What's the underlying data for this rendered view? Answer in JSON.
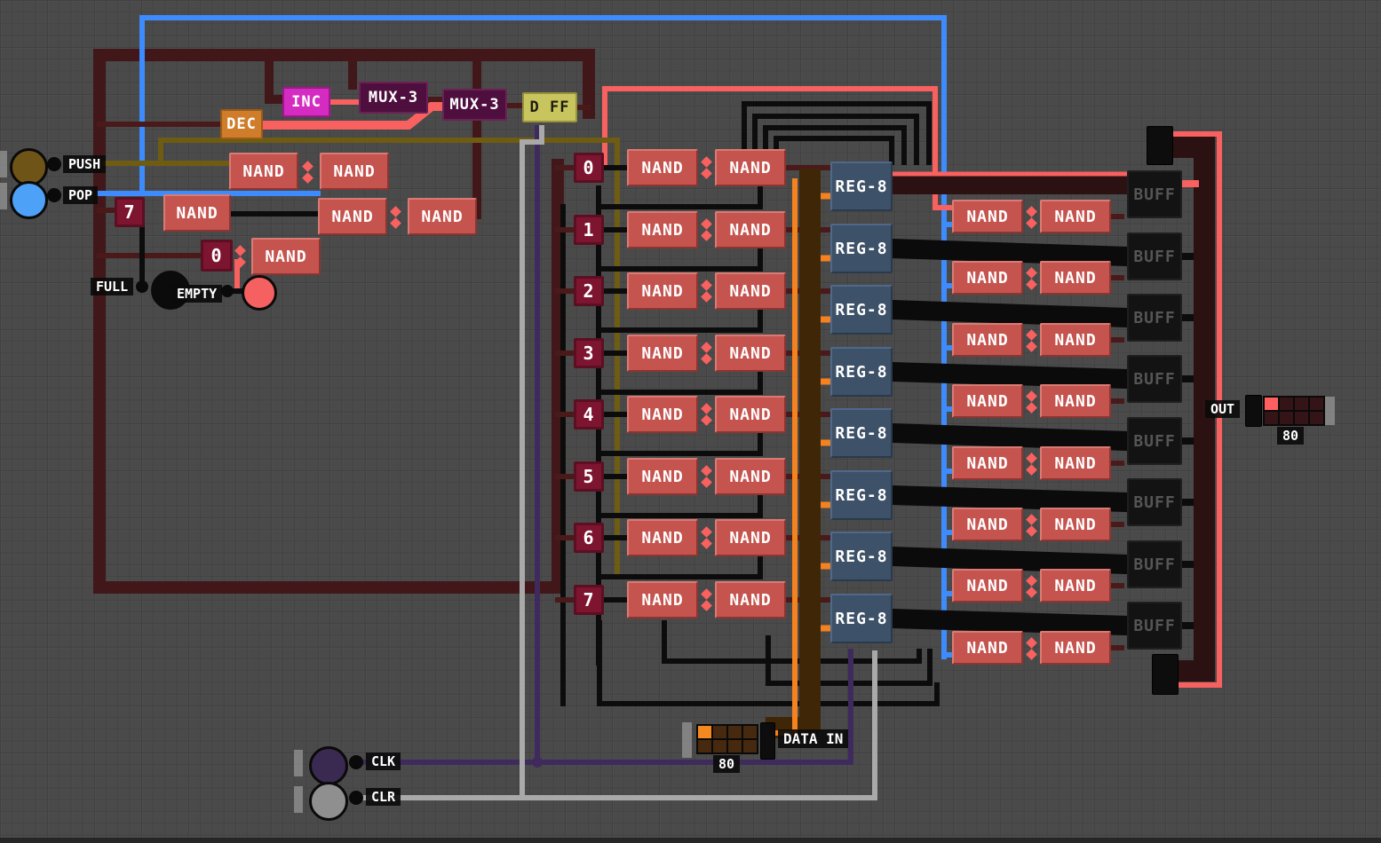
{
  "palette": {
    "wire_blue": "#3d8bfd",
    "wire_on_red": "#f8615f",
    "wire_dark_red": "#4a1a1a",
    "bus_maroon": "#421719",
    "bus_out_dark": "#2c1113",
    "wire_black": "#0c0c0c",
    "wire_olive": "#6e5c12",
    "wire_orange": "#f5821e",
    "bus_brown": "#3f2607",
    "wire_purple": "#3f2a5e",
    "wire_gray": "#a9a9a9",
    "nand_red": "#c5544f",
    "reg_blue": "#3d5168",
    "buff_black": "#131313",
    "idx_crimson": "#7d1430",
    "light_on": "#f56060",
    "light_off": "#0b0b0b"
  },
  "io": {
    "push": {
      "label": "PUSH",
      "color": "#6f5418"
    },
    "pop": {
      "label": "POP",
      "color": "#4da1f7"
    },
    "clk": {
      "label": "CLK",
      "color": "#3a2a52"
    },
    "clr": {
      "label": "CLR",
      "color": "#8f8f8f"
    }
  },
  "indicators": {
    "full": {
      "label": "FULL",
      "on": false
    },
    "empty": {
      "label": "EMPTY",
      "on": true
    }
  },
  "chips": {
    "dec": "DEC",
    "inc": "INC",
    "mux_a": "MUX-3",
    "mux_b": "MUX-3",
    "dff": "D FF"
  },
  "left": {
    "const_seven": "7",
    "const_zero": "0"
  },
  "gate_label": "NAND",
  "reg_label": "REG-8",
  "buff_label": "BUFF",
  "index_labels": [
    "0",
    "1",
    "2",
    "3",
    "4",
    "5",
    "6",
    "7"
  ],
  "counts": {
    "mid_rows": 8,
    "right_rows": 8,
    "reg8": 8,
    "buff": 8,
    "left_nands": 6
  },
  "data_in": {
    "label": "DATA IN",
    "value": "80",
    "bits": [
      1,
      0,
      0,
      0,
      0,
      0,
      0,
      0
    ]
  },
  "out": {
    "label": "OUT",
    "value": "80",
    "bits": [
      1,
      0,
      0,
      0,
      0,
      0,
      0,
      0
    ]
  }
}
